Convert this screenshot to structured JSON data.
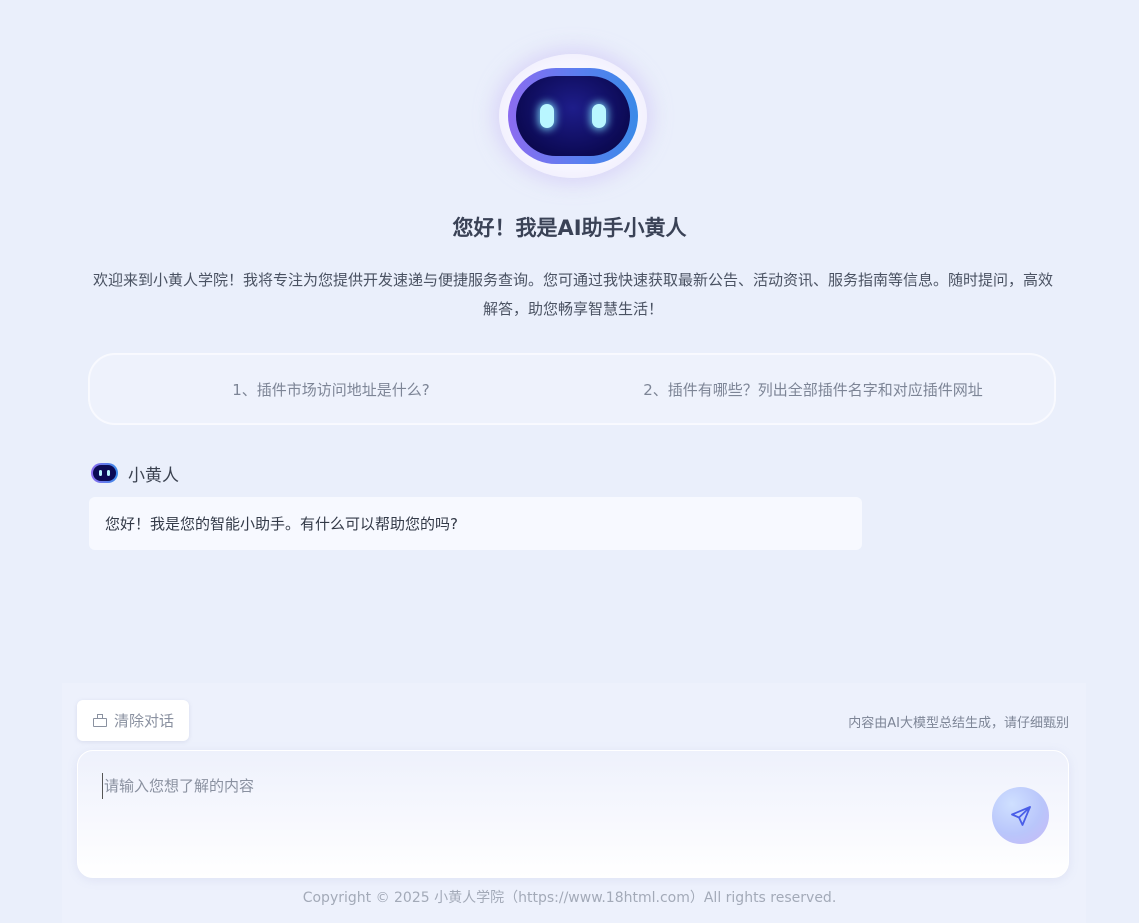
{
  "welcome": {
    "title": "您好！我是AI助手小黄人",
    "description": "欢迎来到小黄人学院！我将专注为您提供开发速递与便捷服务查询。您可通过我快速获取最新公告、活动资讯、服务指南等信息。随时提问，高效解答，助您畅享智慧生活！"
  },
  "suggestions": [
    "1、插件市场访问地址是什么?",
    "2、插件有哪些？列出全部插件名字和对应插件网址"
  ],
  "chat": {
    "bot_name": "小黄人",
    "messages": [
      "您好！我是您的智能小助手。有什么可以帮助您的吗?"
    ]
  },
  "toolbar": {
    "clear_label": "清除对话",
    "disclaimer": "内容由AI大模型总结生成，请仔细甄别"
  },
  "input": {
    "placeholder": "请输入您想了解的内容",
    "value": ""
  },
  "footer": {
    "copyright": "Copyright © 2025 小黄人学院（https://www.18html.com）All rights reserved."
  },
  "icons": {
    "avatar": "robot-avatar-icon",
    "clear": "broom-icon",
    "send": "paper-plane-icon"
  },
  "colors": {
    "background": "#eaeffb",
    "accent": "#4a5ee8"
  }
}
